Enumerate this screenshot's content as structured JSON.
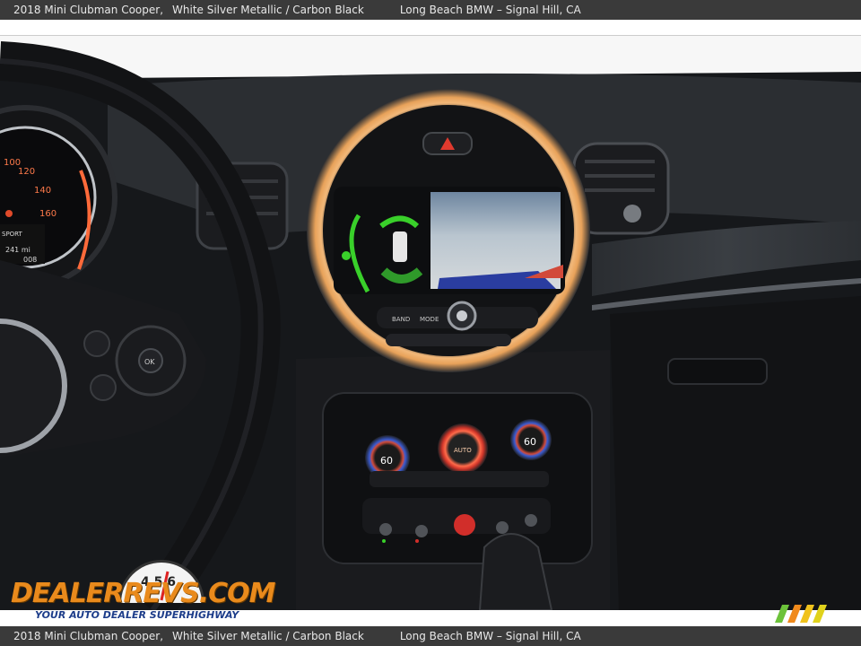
{
  "caption": {
    "model": "2018 Mini Clubman Cooper,",
    "color": "White Silver Metallic  /  Carbon Black",
    "dealer": "Long Beach BMW – Signal Hill, CA"
  },
  "photo": {
    "speedometer_ticks": [
      "100",
      "120",
      "140",
      "160"
    ],
    "cluster_mode": "SPORT",
    "cluster_range": "241 mi",
    "cluster_odometer": "008",
    "radio_buttons": [
      "BAND",
      "MODE"
    ],
    "climate_temps": [
      "60",
      "AUTO",
      "60"
    ],
    "wheel_center_button": "OK"
  },
  "watermark": {
    "brand": "DEALERREVS.COM",
    "tagline": "YOUR AUTO DEALER SUPERHIGHWAY",
    "gauge_digits": "4 5 6"
  },
  "colors": {
    "caption_bg": "#3a3a3a",
    "caption_text": "#e8e8e8",
    "ring_glow": "#e8a25a",
    "watermark_orange": "#e98a1c",
    "watermark_blue": "#1d3d8a"
  }
}
